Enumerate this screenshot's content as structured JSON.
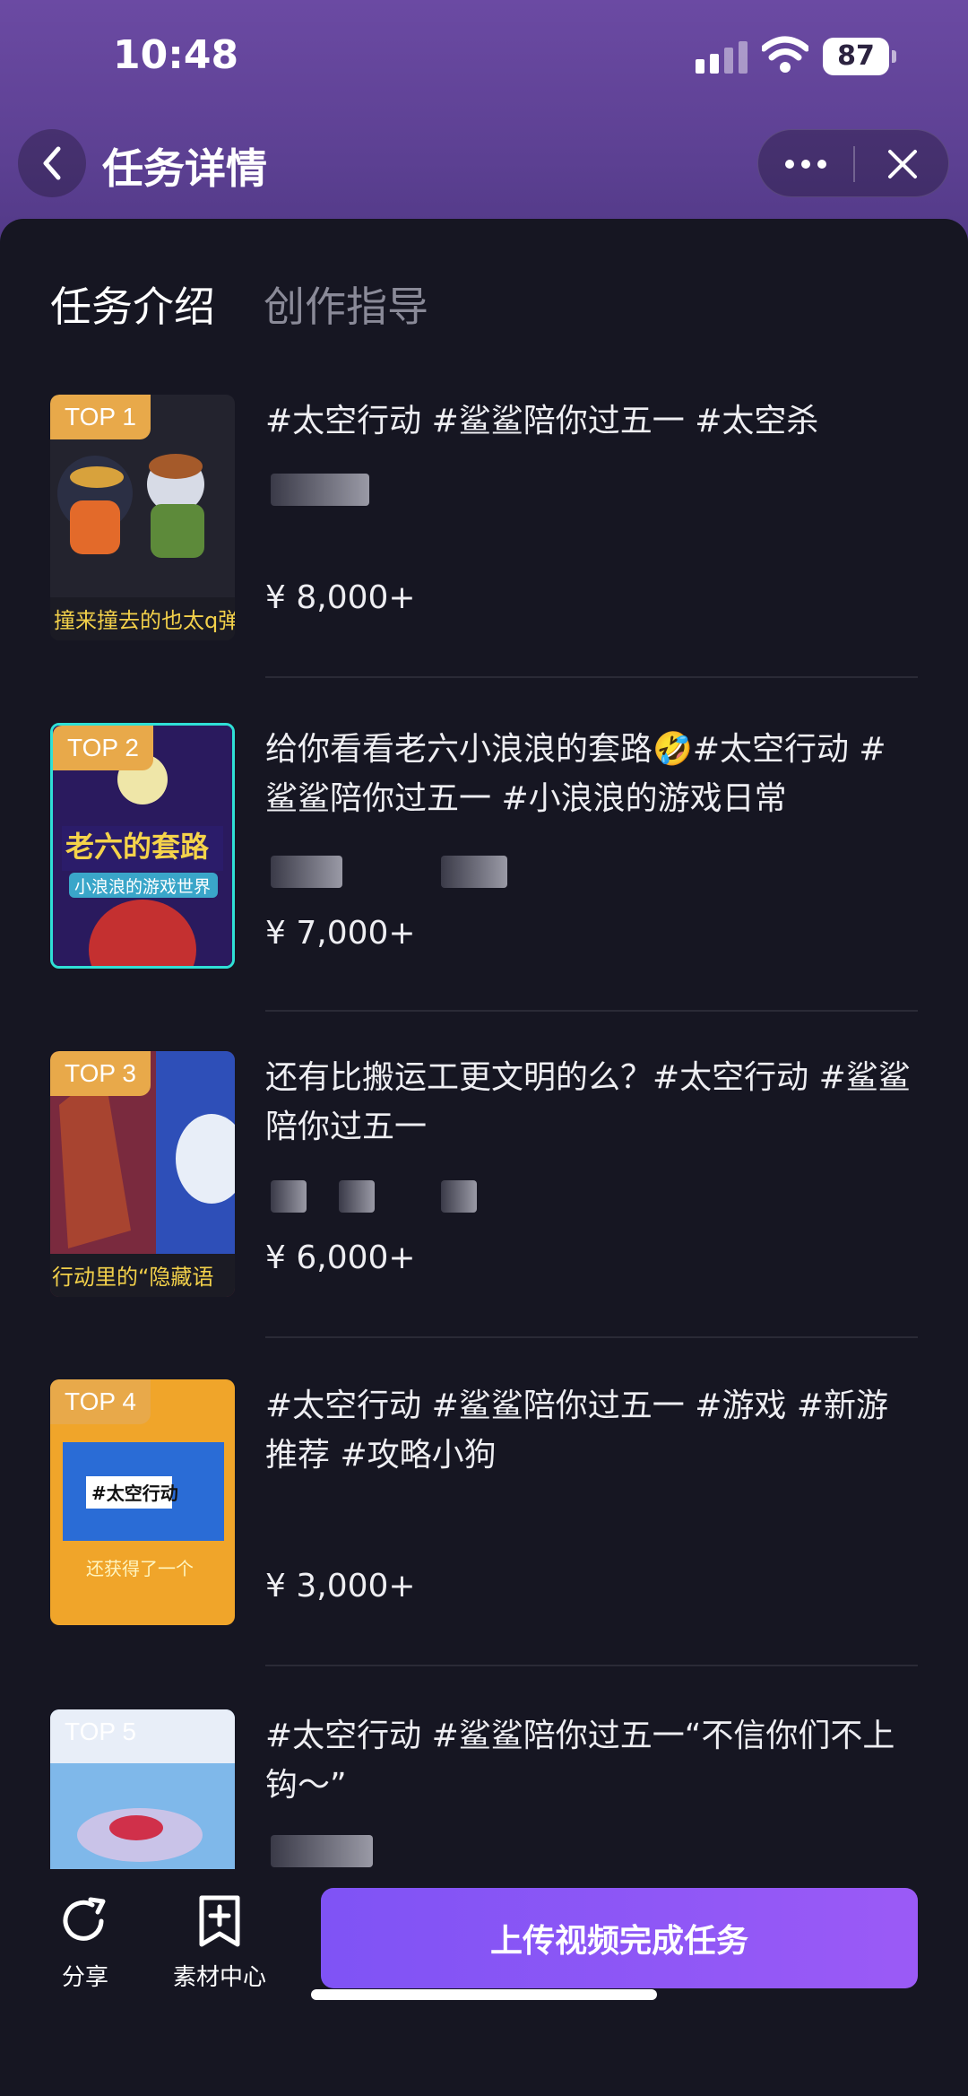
{
  "status": {
    "time": "10:48",
    "battery": "87"
  },
  "nav": {
    "title": "任务详情"
  },
  "tabs": [
    {
      "label": "任务介绍",
      "active": true
    },
    {
      "label": "创作指导",
      "active": false
    }
  ],
  "tasks": [
    {
      "rank": "TOP 1",
      "text": "#太空行动 #鲨鲨陪你过五一 #太空杀",
      "price": "¥ 8,000+"
    },
    {
      "rank": "TOP 2",
      "text": "给你看看老六小浪浪的套路🤣#太空行动 #鲨鲨陪你过五一 #小浪浪的游戏日常",
      "price": "¥ 7,000+"
    },
    {
      "rank": "TOP 3",
      "text": "还有比搬运工更文明的么？#太空行动 #鲨鲨陪你过五一",
      "price": "¥ 6,000+"
    },
    {
      "rank": "TOP 4",
      "text": "#太空行动 #鲨鲨陪你过五一 #游戏 #新游推荐 #攻略小狗",
      "price": "¥ 3,000+"
    },
    {
      "rank": "TOP 5",
      "text": "#太空行动 #鲨鲨陪你过五一“不信你们不上钩～”",
      "price": ""
    }
  ],
  "bottom": {
    "share_label": "分享",
    "material_label": "素材中心",
    "upload_label": "上传视频完成任务"
  },
  "colors": {
    "accent": "#7b5cf6",
    "badge": "#e8a94a",
    "header": "#5c4092"
  }
}
